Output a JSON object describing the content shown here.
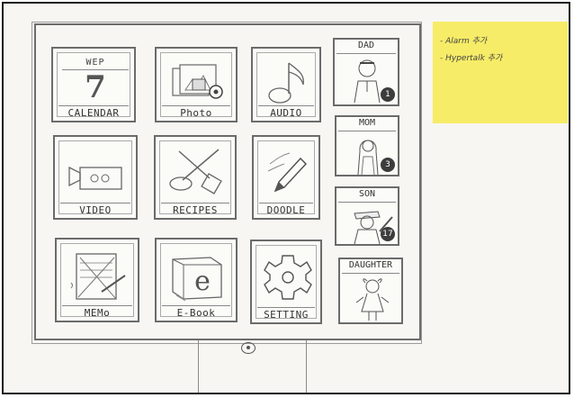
{
  "apps": {
    "calendar": {
      "label": "CALENDAR",
      "day": "WEP",
      "date": "7"
    },
    "photo": {
      "label": "Photo"
    },
    "audio": {
      "label": "AUDIO"
    },
    "video": {
      "label": "VIDEO"
    },
    "recipes": {
      "label": "RECIPES"
    },
    "doodle": {
      "label": "DOODLE"
    },
    "memo": {
      "label": "MEMo"
    },
    "ebook": {
      "label": "E-Book",
      "icon_letter": "e"
    },
    "setting": {
      "label": "SETTING"
    }
  },
  "contacts": [
    {
      "name": "DAD",
      "badge": "1"
    },
    {
      "name": "MOM",
      "badge": "3"
    },
    {
      "name": "SON",
      "badge": "17"
    },
    {
      "name": "DAUGHTER",
      "badge": ""
    }
  ],
  "note": {
    "items": [
      "- Alarm 추가",
      "- Hypertalk 추가"
    ]
  },
  "colors": {
    "note_bg": "#f7ec67",
    "sketch_line": "#6b6b6b"
  }
}
